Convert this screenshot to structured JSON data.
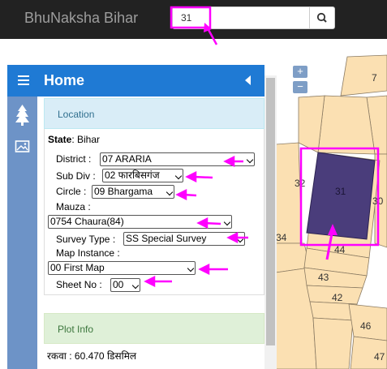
{
  "app": {
    "title": "BhuNaksha Bihar"
  },
  "search": {
    "value": "31"
  },
  "map": {
    "zoom_in_label": "+",
    "zoom_out_label": "−",
    "highlighted_plot": "31",
    "plot_labels": [
      "7",
      "32",
      "31",
      "30",
      "34",
      "44",
      "43",
      "42",
      "46",
      "47"
    ],
    "colors": {
      "parcel_fill": "#fbe0b2",
      "parcel_border": "#8a7a62",
      "selected_fill": "#4a3d7b",
      "highlight": "#ff00ff"
    }
  },
  "panel": {
    "header_title": "Home",
    "sections": {
      "location_title": "Location",
      "plot_info_title": "Plot Info"
    },
    "state": {
      "label": "State",
      "value": "Bihar"
    },
    "fields": {
      "district_label": "District :",
      "district_value": "07 ARARIA",
      "subdiv_label": "Sub Div :",
      "subdiv_value": "02 फारबिसगंज",
      "circle_label": "Circle :",
      "circle_value": "09 Bhargama",
      "mauza_label": "Mauza :",
      "mauza_value": "0754 Chaura(84)",
      "survey_type_label": "Survey Type :",
      "survey_type_value": "SS Special Survey",
      "map_instance_label": "Map Instance :",
      "map_instance_value": "00 First Map",
      "sheet_no_label": "Sheet No :",
      "sheet_no_value": "00"
    },
    "plot_info": {
      "area_text": "रकवा : 60.470 डिसमिल"
    },
    "colors": {
      "header": "#1f7ad4",
      "side_strip": "#6d93c7",
      "location_head_bg": "#d9edf7",
      "plot_head_bg": "#dff0d8",
      "annotation": "#ff00ff"
    }
  }
}
